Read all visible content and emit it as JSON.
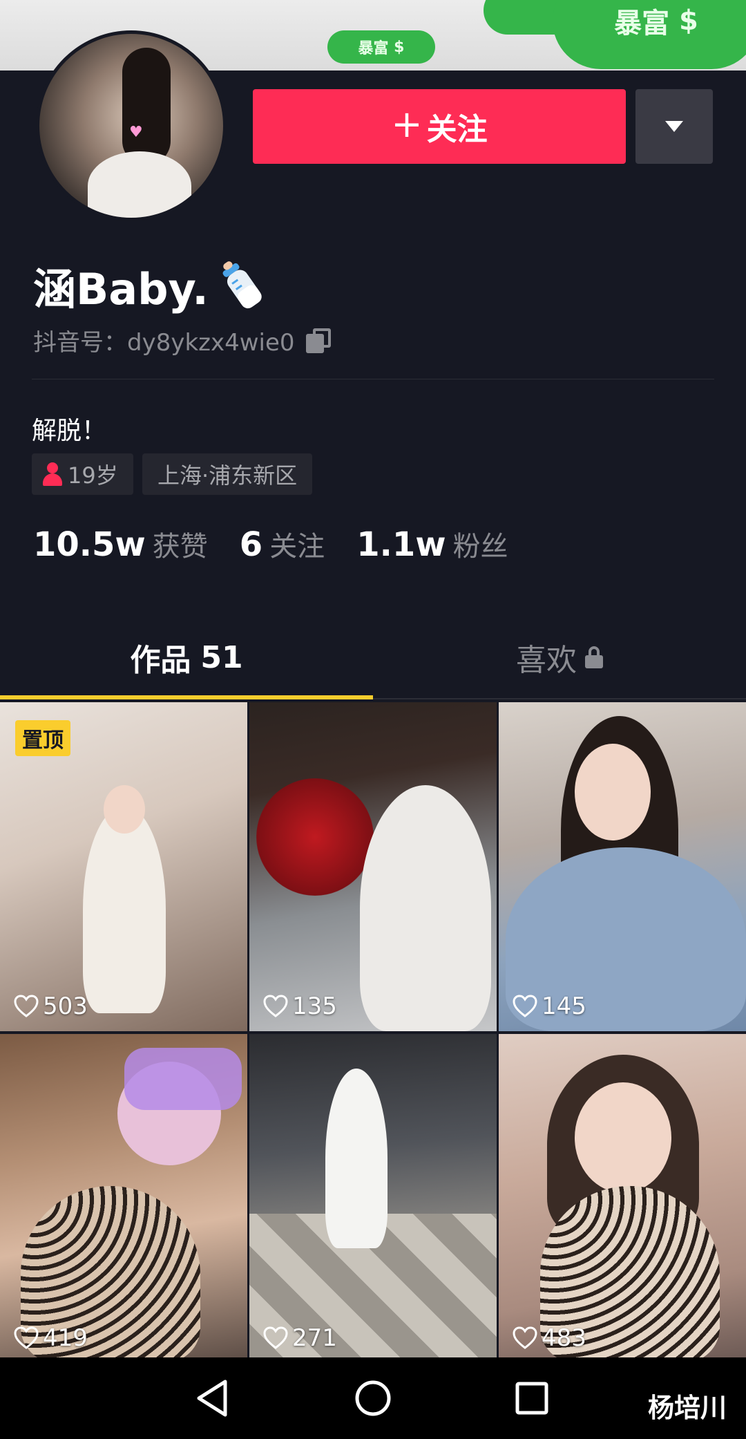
{
  "profile": {
    "nickname": "涵Baby.",
    "douyin_id": "抖音号：dy8ykzx4wie0",
    "bio": "解脱！",
    "age": "19岁",
    "location": "上海·浦东新区"
  },
  "cover": {
    "sticker_text": "暴富"
  },
  "actions": {
    "follow_plus": "+",
    "follow_label": "关注"
  },
  "stats": [
    {
      "num": "10.5w",
      "label": "获赞"
    },
    {
      "num": "6",
      "label": "关注"
    },
    {
      "num": "1.1w",
      "label": "粉丝"
    }
  ],
  "tabs": {
    "works_label": "作品",
    "works_count": "51",
    "likes_label": "喜欢"
  },
  "videos": [
    {
      "likes": "503",
      "pinned_label": "置顶"
    },
    {
      "likes": "135"
    },
    {
      "likes": "145"
    },
    {
      "likes": "419"
    },
    {
      "likes": "271"
    },
    {
      "likes": "483"
    }
  ],
  "watermark": "杨培川",
  "colors": {
    "background": "#161823",
    "follow": "#fe2c55",
    "tab_indicator": "#facd2d"
  }
}
